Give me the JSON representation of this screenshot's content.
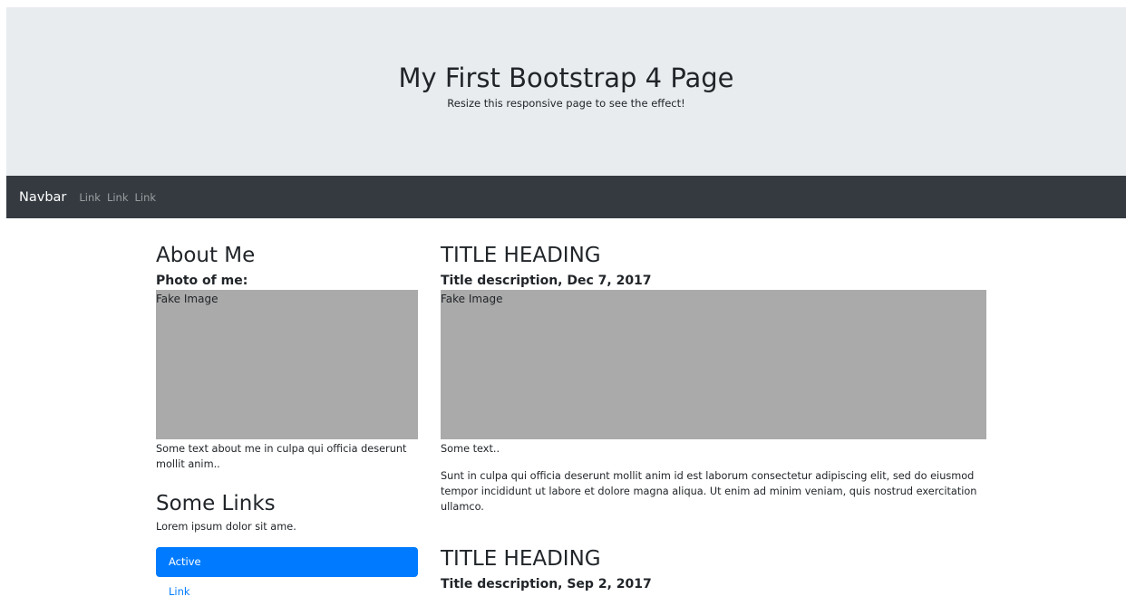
{
  "jumbotron": {
    "title": "My First Bootstrap 4 Page",
    "subtitle": "Resize this responsive page to see the effect!"
  },
  "navbar": {
    "brand": "Navbar",
    "links": [
      "Link",
      "Link",
      "Link"
    ]
  },
  "left": {
    "heading": "About Me",
    "photo_label": "Photo of me:",
    "image_text": "Fake Image",
    "about_text": "Some text about me in culpa qui officia deserunt mollit anim..",
    "links_heading": "Some Links",
    "links_text": "Lorem ipsum dolor sit ame.",
    "pills": {
      "active": "Active",
      "link": "Link"
    }
  },
  "posts": [
    {
      "heading": "TITLE HEADING",
      "description": "Title description, Dec 7, 2017",
      "image_text": "Fake Image",
      "short_text": "Some text..",
      "body": "Sunt in culpa qui officia deserunt mollit anim id est laborum consectetur adipiscing elit, sed do eiusmod tempor incididunt ut labore et dolore magna aliqua. Ut enim ad minim veniam, quis nostrud exercitation ullamco."
    },
    {
      "heading": "TITLE HEADING",
      "description": "Title description, Sep 2, 2017"
    }
  ],
  "colors": {
    "jumbotron_bg": "#e9ecef",
    "navbar_bg": "#343a40",
    "primary": "#007bff",
    "image_placeholder": "#aaaaaa"
  }
}
